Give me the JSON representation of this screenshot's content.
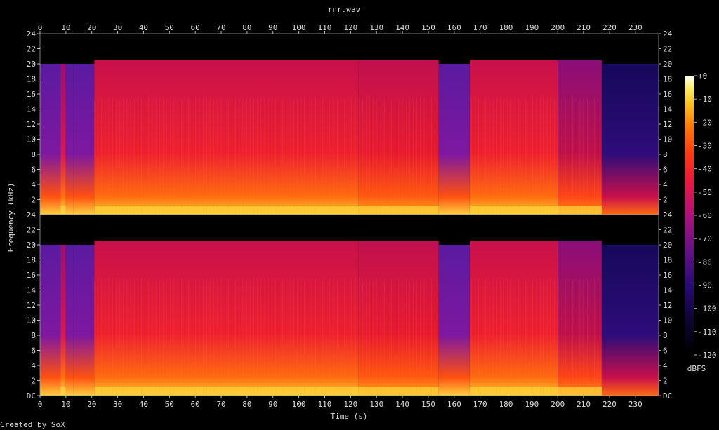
{
  "chart_data": {
    "type": "heatmap",
    "title": "rnr.wav",
    "xlabel": "Time (s)",
    "ylabel": "Frequency (kHz)",
    "xlim": [
      0,
      239
    ],
    "ylim": [
      0,
      24
    ],
    "x_ticks": [
      0,
      10,
      20,
      30,
      40,
      50,
      60,
      70,
      80,
      90,
      100,
      110,
      120,
      130,
      140,
      150,
      160,
      170,
      180,
      190,
      200,
      210,
      220,
      230
    ],
    "y_ticks": [
      {
        "v": 0,
        "label": "DC"
      },
      {
        "v": 2,
        "label": "2"
      },
      {
        "v": 4,
        "label": "4"
      },
      {
        "v": 6,
        "label": "6"
      },
      {
        "v": 8,
        "label": "8"
      },
      {
        "v": 10,
        "label": "10"
      },
      {
        "v": 12,
        "label": "12"
      },
      {
        "v": 14,
        "label": "14"
      },
      {
        "v": 16,
        "label": "16"
      },
      {
        "v": 18,
        "label": "18"
      },
      {
        "v": 20,
        "label": "20"
      },
      {
        "v": 22,
        "label": "22"
      },
      {
        "v": 24,
        "label": "24"
      }
    ],
    "channels": 2,
    "colorbar": {
      "label": "dBFS",
      "range": [
        -120,
        0
      ],
      "ticks": [
        "+0",
        "-10",
        "-20",
        "-30",
        "-40",
        "-50",
        "-60",
        "-70",
        "-80",
        "-90",
        "-100",
        "-110",
        "-120"
      ]
    },
    "segments": [
      {
        "t0": 0,
        "t1": 8,
        "level": "quiet",
        "cutoff_khz": 20
      },
      {
        "t0": 8,
        "t1": 10,
        "level": "transient",
        "cutoff_khz": 20
      },
      {
        "t0": 10,
        "t1": 13,
        "level": "quiet",
        "cutoff_khz": 20
      },
      {
        "t0": 13,
        "t1": 21,
        "level": "quiet",
        "cutoff_khz": 20
      },
      {
        "t0": 21,
        "t1": 123,
        "level": "loud",
        "cutoff_khz": 20.5
      },
      {
        "t0": 123,
        "t1": 154,
        "level": "loud-sparse",
        "cutoff_khz": 20.5
      },
      {
        "t0": 154,
        "t1": 166,
        "level": "quiet",
        "cutoff_khz": 20
      },
      {
        "t0": 166,
        "t1": 200,
        "level": "loud",
        "cutoff_khz": 20.5
      },
      {
        "t0": 200,
        "t1": 217,
        "level": "medium",
        "cutoff_khz": 20.5
      },
      {
        "t0": 217,
        "t1": 239,
        "level": "fade",
        "cutoff_khz": 20
      }
    ]
  },
  "footer": {
    "credit": "Created by SoX"
  }
}
